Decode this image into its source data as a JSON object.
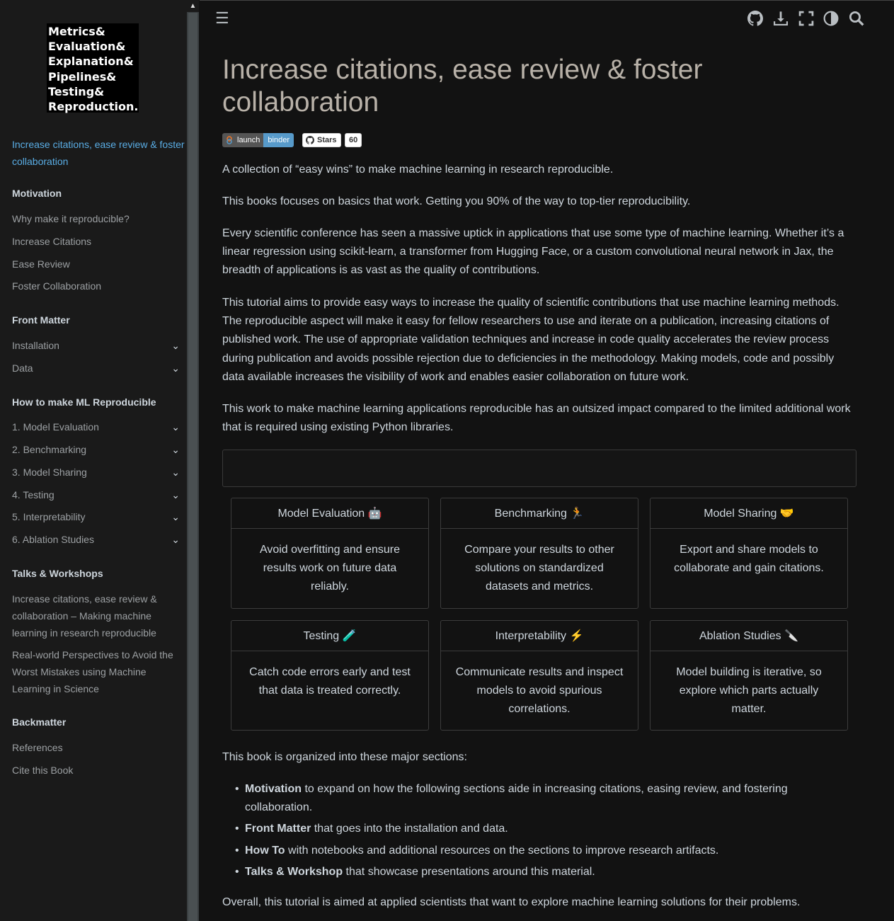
{
  "sidebar": {
    "logo_text": "Metrics&\nEvaluation&\nExplanation&\nPipelines&\nTesting&\nReproduction.",
    "active_item": "Increase citations, ease review & foster collaboration",
    "captions": {
      "motivation": "Motivation",
      "front_matter": "Front Matter",
      "how_to": "How to make ML Reproducible",
      "talks": "Talks & Workshops",
      "backmatter": "Backmatter"
    },
    "motivation_items": [
      "Why make it reproducible?",
      "Increase Citations",
      "Ease Review",
      "Foster Collaboration"
    ],
    "front_matter_items": [
      "Installation",
      "Data"
    ],
    "how_to_items": [
      "1. Model Evaluation",
      "2. Benchmarking",
      "3. Model Sharing",
      "4. Testing",
      "5. Interpretability",
      "6. Ablation Studies"
    ],
    "talks_items": [
      "Increase citations, ease review & collaboration – Making machine learning in research reproducible",
      "Real-world Perspectives to Avoid the Worst Mistakes using Machine Learning in Science"
    ],
    "backmatter_items": [
      "References",
      "Cite this Book"
    ]
  },
  "topbar": {
    "icons": [
      "menu-icon",
      "github-icon",
      "download-icon",
      "fullscreen-icon",
      "theme-icon",
      "search-icon"
    ]
  },
  "main": {
    "title": "Increase citations, ease review & foster collaboration",
    "badges": {
      "launch": "launch",
      "binder": "binder",
      "stars": "Stars",
      "stars_count": "60"
    },
    "intro_1": "A collection of “easy wins” to make machine learning in research reproducible.",
    "intro_2": "This books focuses on basics that work. Getting you 90% of the way to top-tier reproducibility.",
    "intro_3": "Every scientific conference has seen a massive uptick in applications that use some type of machine learning. Whether it’s a linear regression using scikit-learn, a transformer from Hugging Face, or a custom convolutional neural network in Jax, the breadth of applications is as vast as the quality of contributions.",
    "intro_4": "This tutorial aims to provide easy ways to increase the quality of scientific contributions that use machine learning methods. The reproducible aspect will make it easy for fellow researchers to use and iterate on a publication, increasing citations of published work. The use of appropriate validation techniques and increase in code quality accelerates the review process during publication and avoids possible rejection due to deficiencies in the methodology. Making models, code and possibly data available increases the visibility of work and enables easier collaboration on future work.",
    "intro_5": "This work to make machine learning applications reproducible has an outsized impact compared to the limited additional work that is required using existing Python libraries.",
    "cards": [
      {
        "title": "Model Evaluation",
        "emoji": "🤖",
        "body": "Avoid overfitting and ensure results work on future data reliably."
      },
      {
        "title": "Benchmarking",
        "emoji": "🏃",
        "body": "Compare your results to other solutions on standardized datasets and metrics."
      },
      {
        "title": "Model Sharing",
        "emoji": "🤝",
        "body": "Export and share models to collaborate and gain citations."
      },
      {
        "title": "Testing",
        "emoji": "🧪",
        "body": "Catch code errors early and test that data is treated correctly."
      },
      {
        "title": "Interpretability",
        "emoji": "⚡",
        "body": "Communicate results and inspect models to avoid spurious correlations."
      },
      {
        "title": "Ablation Studies",
        "emoji": "🔪",
        "body": "Model building is iterative, so explore which parts actually matter."
      }
    ],
    "organized_intro": "This book is organized into these major sections:",
    "sections": [
      {
        "bold": "Motivation",
        "rest": " to expand on how the following sections aide in increasing citations, easing review, and fostering collaboration."
      },
      {
        "bold": "Front Matter",
        "rest": " that goes into the installation and data."
      },
      {
        "bold": "How To",
        "rest": " with notebooks and additional resources on the sections to improve research artifacts."
      },
      {
        "bold": "Talks & Workshop",
        "rest": " that showcase presentations around this material."
      }
    ],
    "overall": "Overall, this tutorial is aimed at applied scientists that want to explore machine learning solutions for their problems."
  }
}
